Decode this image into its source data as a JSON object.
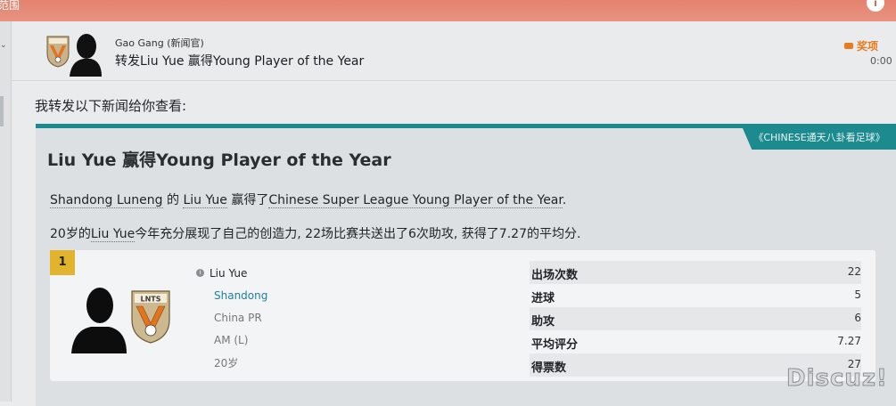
{
  "window": {
    "title_fragment": "范围"
  },
  "message": {
    "sender": "Gao Gang (新闻官)",
    "subject": "转发Liu Yue 赢得Young Player of the Year",
    "tag": "奖项",
    "time": "0:00"
  },
  "intro": "我转发以下新闻给你查看:",
  "article": {
    "source": "《CHINESE通天八卦看足球》",
    "headline": "Liu Yue 赢得Young Player of the Year",
    "para1": {
      "club": "Shandong Luneng",
      "de": " 的 ",
      "player": "Liu Yue",
      "won": " 赢得了",
      "award": "Chinese Super League Young Player of the Year",
      "end": "."
    },
    "para2": {
      "age": "20岁的",
      "player": "Liu Yue",
      "rest": "今年充分展现了自己的创造力, 22场比赛共送出了6次助攻, 获得了7.27的平均分."
    }
  },
  "player_card": {
    "rank": "1",
    "name": "Liu Yue",
    "club": "Shandong",
    "nationality": "China PR",
    "position": "AM (L)",
    "age": "20岁",
    "stats": [
      {
        "label": "出场次数",
        "value": "22"
      },
      {
        "label": "进球",
        "value": "5"
      },
      {
        "label": "助攻",
        "value": "6"
      },
      {
        "label": "平均评分",
        "value": "7.27"
      },
      {
        "label": "得票数",
        "value": "27"
      }
    ]
  },
  "watermark": "Discuz!",
  "colors": {
    "accent": "#1c8a8f",
    "topbar": "#e4826f",
    "award": "#e87b1e",
    "rank": "#e2b42d",
    "link": "#1f80a0"
  },
  "icons": [
    "info-icon",
    "club-crest-icon",
    "player-silhouette-icon",
    "award-tag-icon",
    "chevron-down-icon"
  ]
}
